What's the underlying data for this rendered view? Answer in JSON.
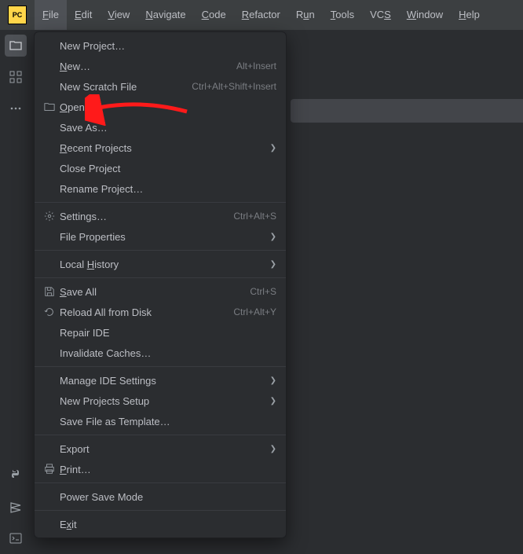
{
  "app_logo": "PC",
  "menubar": {
    "file": "File",
    "edit": "Edit",
    "view": "View",
    "navigate": "Navigate",
    "code": "Code",
    "refactor": "Refactor",
    "run": "Run",
    "tools": "Tools",
    "vcs": "VCS",
    "window": "Window",
    "help": "Help"
  },
  "file_menu": {
    "new_project": "New Project…",
    "new": "New…",
    "new_shortcut": "Alt+Insert",
    "new_scratch": "New Scratch File",
    "new_scratch_shortcut": "Ctrl+Alt+Shift+Insert",
    "open": "Open…",
    "save_as": "Save As…",
    "recent_projects": "Recent Projects",
    "close_project": "Close Project",
    "rename_project": "Rename Project…",
    "settings": "Settings…",
    "settings_shortcut": "Ctrl+Alt+S",
    "file_properties": "File Properties",
    "local_history": "Local History",
    "save_all": "Save All",
    "save_all_shortcut": "Ctrl+S",
    "reload": "Reload All from Disk",
    "reload_shortcut": "Ctrl+Alt+Y",
    "repair_ide": "Repair IDE",
    "invalidate": "Invalidate Caches…",
    "manage_ide": "Manage IDE Settings",
    "new_projects_setup": "New Projects Setup",
    "save_template": "Save File as Template…",
    "export": "Export",
    "print": "Print…",
    "power_save": "Power Save Mode",
    "exit": "Exit"
  }
}
